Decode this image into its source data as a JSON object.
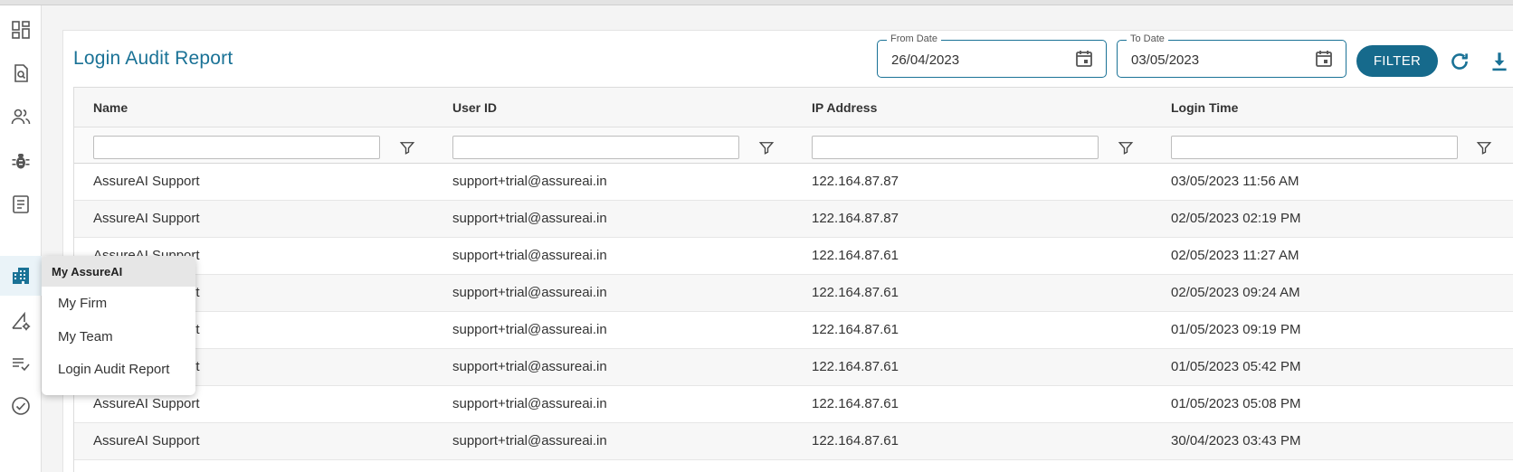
{
  "page": {
    "title": "Login Audit Report",
    "accent_color": "#1a7296"
  },
  "sidebar": {
    "items": [
      {
        "icon": "dashboard-icon"
      },
      {
        "icon": "document-search-icon"
      },
      {
        "icon": "users-icon"
      },
      {
        "icon": "bug-icon"
      },
      {
        "icon": "notes-icon"
      },
      {
        "icon": "building-icon",
        "active": true
      },
      {
        "icon": "settings-triangle-icon"
      },
      {
        "icon": "checklist-icon"
      },
      {
        "icon": "check-circle-icon"
      }
    ]
  },
  "filters": {
    "from_label": "From Date",
    "from_value": "26/04/2023",
    "to_label": "To Date",
    "to_value": "03/05/2023",
    "filter_label": "FILTER"
  },
  "table": {
    "columns": [
      "Name",
      "User ID",
      "IP Address",
      "Login Time"
    ],
    "rows": [
      {
        "name": "AssureAI Support",
        "user_id": "support+trial@assureai.in",
        "ip": "122.164.87.87",
        "time": "03/05/2023 11:56 AM"
      },
      {
        "name": "AssureAI Support",
        "user_id": "support+trial@assureai.in",
        "ip": "122.164.87.87",
        "time": "02/05/2023 02:19 PM"
      },
      {
        "name": "AssureAI Support",
        "user_id": "support+trial@assureai.in",
        "ip": "122.164.87.61",
        "time": "02/05/2023 11:27 AM"
      },
      {
        "name": "AssureAI Support",
        "user_id": "support+trial@assureai.in",
        "ip": "122.164.87.61",
        "time": "02/05/2023 09:24 AM"
      },
      {
        "name": "AssureAI Support",
        "user_id": "support+trial@assureai.in",
        "ip": "122.164.87.61",
        "time": "01/05/2023 09:19 PM"
      },
      {
        "name": "AssureAI Support",
        "user_id": "support+trial@assureai.in",
        "ip": "122.164.87.61",
        "time": "01/05/2023 05:42 PM"
      },
      {
        "name": "AssureAI Support",
        "user_id": "support+trial@assureai.in",
        "ip": "122.164.87.61",
        "time": "01/05/2023 05:08 PM"
      },
      {
        "name": "AssureAI Support",
        "user_id": "support+trial@assureai.in",
        "ip": "122.164.87.61",
        "time": "30/04/2023 03:43 PM"
      }
    ]
  },
  "menu": {
    "header": "My AssureAI",
    "items": [
      "My Firm",
      "My Team",
      "Login Audit Report"
    ]
  }
}
